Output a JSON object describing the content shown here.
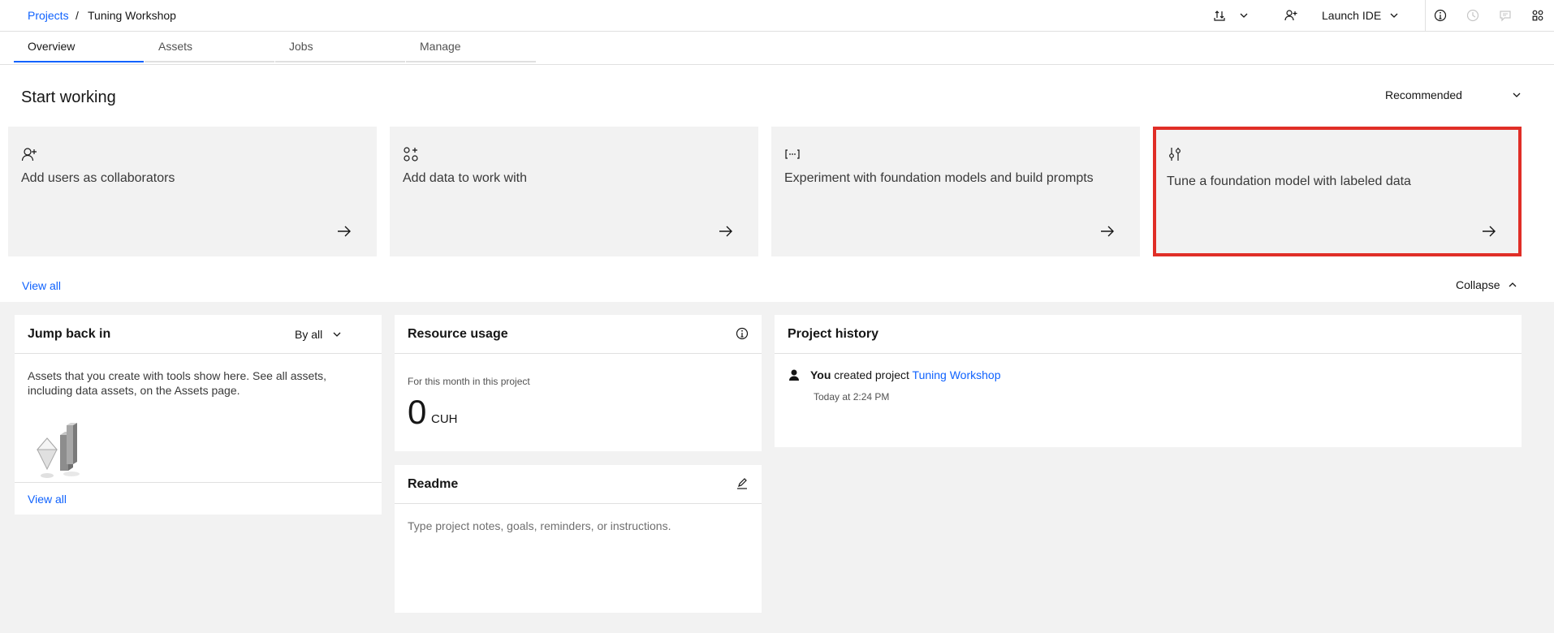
{
  "breadcrumb": {
    "root": "Projects",
    "separator": "/",
    "current": "Tuning Workshop"
  },
  "header": {
    "launch_label": "Launch IDE",
    "icons": [
      "upload-icon",
      "chevron-down-icon",
      "add-user-icon",
      "info-icon",
      "history-icon",
      "comment-icon",
      "apps-icon"
    ]
  },
  "tabs": [
    {
      "label": "Overview",
      "active": true
    },
    {
      "label": "Assets",
      "active": false
    },
    {
      "label": "Jobs",
      "active": false
    },
    {
      "label": "Manage",
      "active": false
    }
  ],
  "start": {
    "title": "Start working",
    "filter": "Recommended",
    "cards": [
      {
        "label": "Add users as collaborators",
        "icon": "add-user-icon"
      },
      {
        "label": "Add data to work with",
        "icon": "data-icon"
      },
      {
        "label": "Experiment with foundation models and build prompts",
        "icon": "prompt-icon"
      },
      {
        "label": "Tune a foundation model with labeled data",
        "icon": "tune-icon",
        "highlighted": true
      }
    ],
    "view_all": "View all",
    "collapse": "Collapse"
  },
  "jump": {
    "title": "Jump back in",
    "filter": "By all",
    "text": "Assets that you create with tools show here. See all assets, including data assets, on the Assets page.",
    "view_all": "View all"
  },
  "resource": {
    "title": "Resource usage",
    "caption": "For this month in this project",
    "value": "0",
    "unit": "CUH"
  },
  "readme": {
    "title": "Readme",
    "placeholder": "Type project notes, goals, reminders, or instructions."
  },
  "history": {
    "title": "Project history",
    "actor": "You",
    "action": "created project",
    "project": "Tuning Workshop",
    "time": "Today at 2:24 PM"
  },
  "colors": {
    "accent": "#0f62fe",
    "highlight": "#e02e27",
    "panel": "#f2f2f2"
  }
}
